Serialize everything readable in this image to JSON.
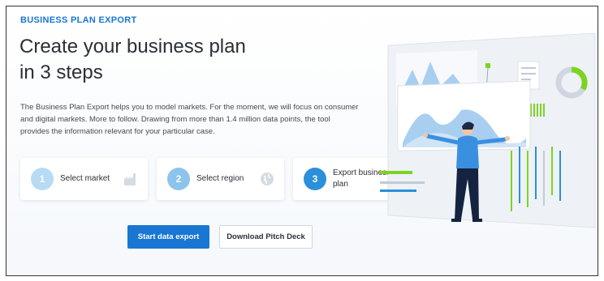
{
  "header": {
    "eyebrow": "BUSINESS PLAN EXPORT",
    "title_line1": "Create your business plan",
    "title_line2": "in 3 steps"
  },
  "description": "The Business Plan Export helps you to model markets. For the moment, we will focus on consumer and digital markets. More to follow. Drawing from more than 1.4 million data points, the tool provides the information relevant for your particular case.",
  "steps": [
    {
      "number": "1",
      "label": "Select market",
      "icon": "factory-icon"
    },
    {
      "number": "2",
      "label": "Select region",
      "icon": "globe-icon"
    },
    {
      "number": "3",
      "label": "Export business plan",
      "icon": "download-icon"
    }
  ],
  "buttons": {
    "primary": "Start data export",
    "secondary": "Download Pitch Deck"
  },
  "colors": {
    "accent": "#1976d2",
    "step1": "#b7dbf4",
    "step2": "#8cc4ec",
    "step3": "#2b8fd9",
    "illustration_green": "#7ed321"
  }
}
